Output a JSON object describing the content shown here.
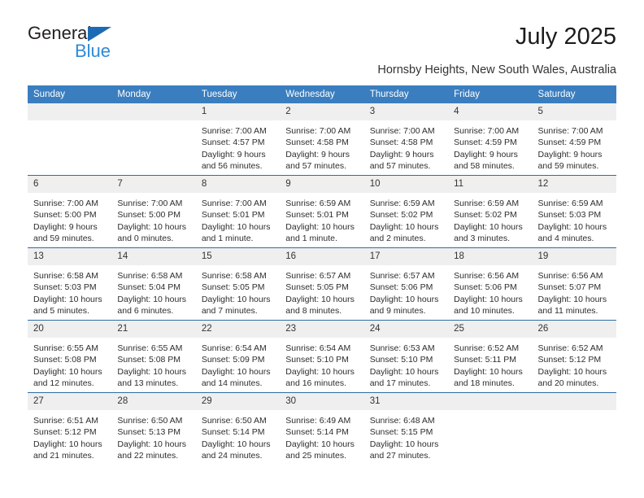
{
  "brand": {
    "name_top": "General",
    "name_bottom": "Blue",
    "triangle_color": "#1b6bb5",
    "bottom_color": "#2e8ad6"
  },
  "header": {
    "month_title": "July 2025",
    "location": "Hornsby Heights, New South Wales, Australia"
  },
  "theme": {
    "header_bg": "#3a7ebf",
    "row_divider": "#2e6da4",
    "daynum_bg": "#efefef",
    "text": "#2d2d2d"
  },
  "weekday_headers": [
    "Sunday",
    "Monday",
    "Tuesday",
    "Wednesday",
    "Thursday",
    "Friday",
    "Saturday"
  ],
  "weeks": [
    [
      {
        "day": "",
        "sunrise": "",
        "sunset": "",
        "daylight1": "",
        "daylight2": ""
      },
      {
        "day": "",
        "sunrise": "",
        "sunset": "",
        "daylight1": "",
        "daylight2": ""
      },
      {
        "day": "1",
        "sunrise": "Sunrise: 7:00 AM",
        "sunset": "Sunset: 4:57 PM",
        "daylight1": "Daylight: 9 hours",
        "daylight2": "and 56 minutes."
      },
      {
        "day": "2",
        "sunrise": "Sunrise: 7:00 AM",
        "sunset": "Sunset: 4:58 PM",
        "daylight1": "Daylight: 9 hours",
        "daylight2": "and 57 minutes."
      },
      {
        "day": "3",
        "sunrise": "Sunrise: 7:00 AM",
        "sunset": "Sunset: 4:58 PM",
        "daylight1": "Daylight: 9 hours",
        "daylight2": "and 57 minutes."
      },
      {
        "day": "4",
        "sunrise": "Sunrise: 7:00 AM",
        "sunset": "Sunset: 4:59 PM",
        "daylight1": "Daylight: 9 hours",
        "daylight2": "and 58 minutes."
      },
      {
        "day": "5",
        "sunrise": "Sunrise: 7:00 AM",
        "sunset": "Sunset: 4:59 PM",
        "daylight1": "Daylight: 9 hours",
        "daylight2": "and 59 minutes."
      }
    ],
    [
      {
        "day": "6",
        "sunrise": "Sunrise: 7:00 AM",
        "sunset": "Sunset: 5:00 PM",
        "daylight1": "Daylight: 9 hours",
        "daylight2": "and 59 minutes."
      },
      {
        "day": "7",
        "sunrise": "Sunrise: 7:00 AM",
        "sunset": "Sunset: 5:00 PM",
        "daylight1": "Daylight: 10 hours",
        "daylight2": "and 0 minutes."
      },
      {
        "day": "8",
        "sunrise": "Sunrise: 7:00 AM",
        "sunset": "Sunset: 5:01 PM",
        "daylight1": "Daylight: 10 hours",
        "daylight2": "and 1 minute."
      },
      {
        "day": "9",
        "sunrise": "Sunrise: 6:59 AM",
        "sunset": "Sunset: 5:01 PM",
        "daylight1": "Daylight: 10 hours",
        "daylight2": "and 1 minute."
      },
      {
        "day": "10",
        "sunrise": "Sunrise: 6:59 AM",
        "sunset": "Sunset: 5:02 PM",
        "daylight1": "Daylight: 10 hours",
        "daylight2": "and 2 minutes."
      },
      {
        "day": "11",
        "sunrise": "Sunrise: 6:59 AM",
        "sunset": "Sunset: 5:02 PM",
        "daylight1": "Daylight: 10 hours",
        "daylight2": "and 3 minutes."
      },
      {
        "day": "12",
        "sunrise": "Sunrise: 6:59 AM",
        "sunset": "Sunset: 5:03 PM",
        "daylight1": "Daylight: 10 hours",
        "daylight2": "and 4 minutes."
      }
    ],
    [
      {
        "day": "13",
        "sunrise": "Sunrise: 6:58 AM",
        "sunset": "Sunset: 5:03 PM",
        "daylight1": "Daylight: 10 hours",
        "daylight2": "and 5 minutes."
      },
      {
        "day": "14",
        "sunrise": "Sunrise: 6:58 AM",
        "sunset": "Sunset: 5:04 PM",
        "daylight1": "Daylight: 10 hours",
        "daylight2": "and 6 minutes."
      },
      {
        "day": "15",
        "sunrise": "Sunrise: 6:58 AM",
        "sunset": "Sunset: 5:05 PM",
        "daylight1": "Daylight: 10 hours",
        "daylight2": "and 7 minutes."
      },
      {
        "day": "16",
        "sunrise": "Sunrise: 6:57 AM",
        "sunset": "Sunset: 5:05 PM",
        "daylight1": "Daylight: 10 hours",
        "daylight2": "and 8 minutes."
      },
      {
        "day": "17",
        "sunrise": "Sunrise: 6:57 AM",
        "sunset": "Sunset: 5:06 PM",
        "daylight1": "Daylight: 10 hours",
        "daylight2": "and 9 minutes."
      },
      {
        "day": "18",
        "sunrise": "Sunrise: 6:56 AM",
        "sunset": "Sunset: 5:06 PM",
        "daylight1": "Daylight: 10 hours",
        "daylight2": "and 10 minutes."
      },
      {
        "day": "19",
        "sunrise": "Sunrise: 6:56 AM",
        "sunset": "Sunset: 5:07 PM",
        "daylight1": "Daylight: 10 hours",
        "daylight2": "and 11 minutes."
      }
    ],
    [
      {
        "day": "20",
        "sunrise": "Sunrise: 6:55 AM",
        "sunset": "Sunset: 5:08 PM",
        "daylight1": "Daylight: 10 hours",
        "daylight2": "and 12 minutes."
      },
      {
        "day": "21",
        "sunrise": "Sunrise: 6:55 AM",
        "sunset": "Sunset: 5:08 PM",
        "daylight1": "Daylight: 10 hours",
        "daylight2": "and 13 minutes."
      },
      {
        "day": "22",
        "sunrise": "Sunrise: 6:54 AM",
        "sunset": "Sunset: 5:09 PM",
        "daylight1": "Daylight: 10 hours",
        "daylight2": "and 14 minutes."
      },
      {
        "day": "23",
        "sunrise": "Sunrise: 6:54 AM",
        "sunset": "Sunset: 5:10 PM",
        "daylight1": "Daylight: 10 hours",
        "daylight2": "and 16 minutes."
      },
      {
        "day": "24",
        "sunrise": "Sunrise: 6:53 AM",
        "sunset": "Sunset: 5:10 PM",
        "daylight1": "Daylight: 10 hours",
        "daylight2": "and 17 minutes."
      },
      {
        "day": "25",
        "sunrise": "Sunrise: 6:52 AM",
        "sunset": "Sunset: 5:11 PM",
        "daylight1": "Daylight: 10 hours",
        "daylight2": "and 18 minutes."
      },
      {
        "day": "26",
        "sunrise": "Sunrise: 6:52 AM",
        "sunset": "Sunset: 5:12 PM",
        "daylight1": "Daylight: 10 hours",
        "daylight2": "and 20 minutes."
      }
    ],
    [
      {
        "day": "27",
        "sunrise": "Sunrise: 6:51 AM",
        "sunset": "Sunset: 5:12 PM",
        "daylight1": "Daylight: 10 hours",
        "daylight2": "and 21 minutes."
      },
      {
        "day": "28",
        "sunrise": "Sunrise: 6:50 AM",
        "sunset": "Sunset: 5:13 PM",
        "daylight1": "Daylight: 10 hours",
        "daylight2": "and 22 minutes."
      },
      {
        "day": "29",
        "sunrise": "Sunrise: 6:50 AM",
        "sunset": "Sunset: 5:14 PM",
        "daylight1": "Daylight: 10 hours",
        "daylight2": "and 24 minutes."
      },
      {
        "day": "30",
        "sunrise": "Sunrise: 6:49 AM",
        "sunset": "Sunset: 5:14 PM",
        "daylight1": "Daylight: 10 hours",
        "daylight2": "and 25 minutes."
      },
      {
        "day": "31",
        "sunrise": "Sunrise: 6:48 AM",
        "sunset": "Sunset: 5:15 PM",
        "daylight1": "Daylight: 10 hours",
        "daylight2": "and 27 minutes."
      },
      {
        "day": "",
        "sunrise": "",
        "sunset": "",
        "daylight1": "",
        "daylight2": ""
      },
      {
        "day": "",
        "sunrise": "",
        "sunset": "",
        "daylight1": "",
        "daylight2": ""
      }
    ]
  ]
}
